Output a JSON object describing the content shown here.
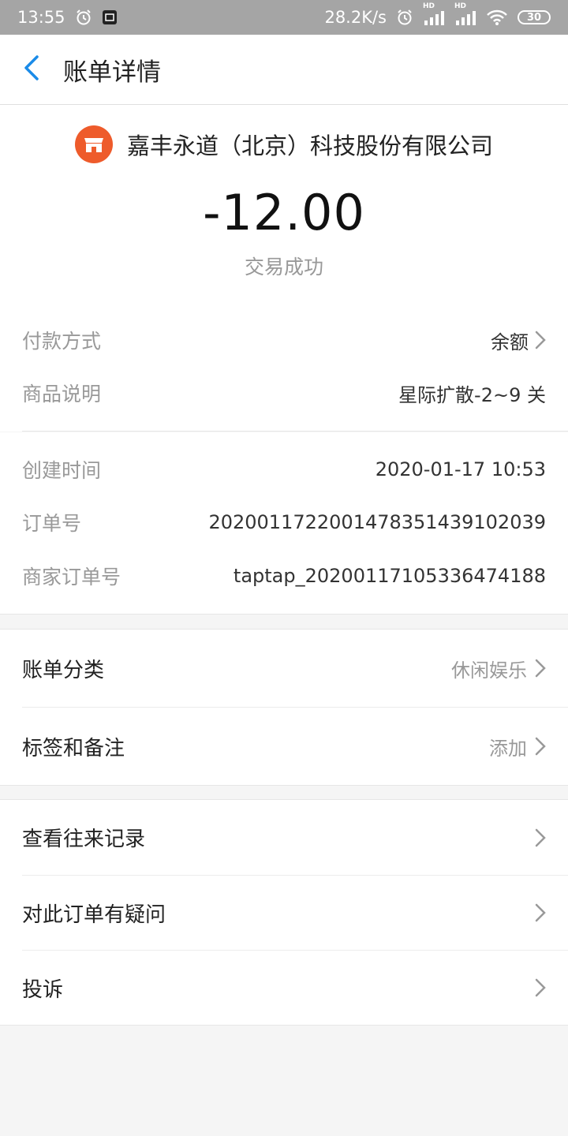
{
  "status_bar": {
    "time": "13:55",
    "speed": "28.2K/s",
    "hd1": "HD",
    "hd2": "HD",
    "battery": "30"
  },
  "nav": {
    "title": "账单详情"
  },
  "summary": {
    "merchant_name": "嘉丰永道（北京）科技股份有限公司",
    "amount": "-12.00",
    "status": "交易成功",
    "payment_method_label": "付款方式",
    "payment_method_value": "余额",
    "product_label": "商品说明",
    "product_value": "星际扩散-2~9 关"
  },
  "details": {
    "created_label": "创建时间",
    "created_value": "2020-01-17 10:53",
    "order_label": "订单号",
    "order_value": "2020011722001478351439102039",
    "merchant_order_label": "商家订单号",
    "merchant_order_value": "taptap_20200117105336474188"
  },
  "category_card": {
    "category_label": "账单分类",
    "category_value": "休闲娱乐",
    "tags_label": "标签和备注",
    "tags_value": "添加"
  },
  "actions_card": {
    "history_label": "查看往来记录",
    "question_label": "对此订单有疑问",
    "complaint_label": "投诉"
  },
  "colors": {
    "accent_blue": "#1a8be8",
    "merchant_orange": "#ee5b2b",
    "status_bar_gray": "#a5a5a5"
  },
  "icons": {
    "back": "chevron-left-icon",
    "alarm": "alarm-clock-icon",
    "screenshot": "screenshot-icon",
    "signal": "signal-bars-icon",
    "wifi": "wifi-icon",
    "merchant": "shop-icon",
    "chevron": "chevron-right-icon"
  }
}
